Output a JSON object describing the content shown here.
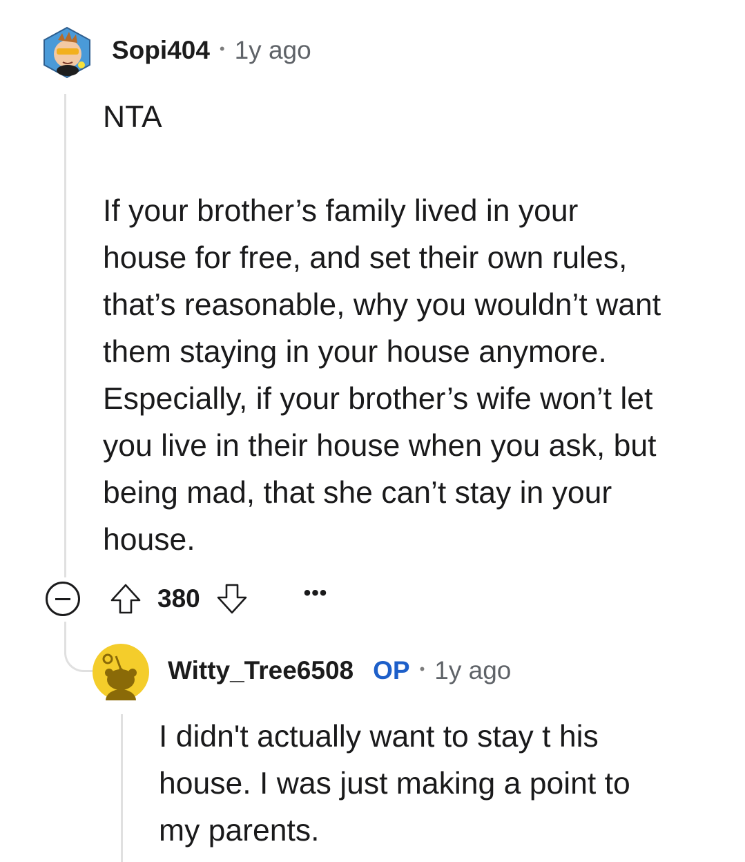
{
  "comment": {
    "author": "Sopi404",
    "separator": "•",
    "time": "1y ago",
    "paragraphs": [
      [
        "NTA"
      ],
      [
        "If your brother’s family lived in your",
        "house for free, and set their own rules,",
        "that’s reasonable, why you wouldn’t want",
        "them staying in your house anymore.",
        "Especially, if your brother’s wife won’t let",
        "you live in their house when you ask, but",
        "being mad, that she can’t stay in your",
        "house."
      ]
    ],
    "score": "380",
    "more": "•••"
  },
  "reply": {
    "author": "Witty_Tree6508",
    "op_badge": "OP",
    "separator": "•",
    "time": "1y ago",
    "lines": [
      "I didn't actually want to stay t his",
      "house. I was just making a point to",
      "my parents."
    ]
  },
  "colors": {
    "op_badge": "#1d5fc9",
    "thread_line": "#e0e0e0",
    "avatar2_bg": "#f4cd2b"
  }
}
